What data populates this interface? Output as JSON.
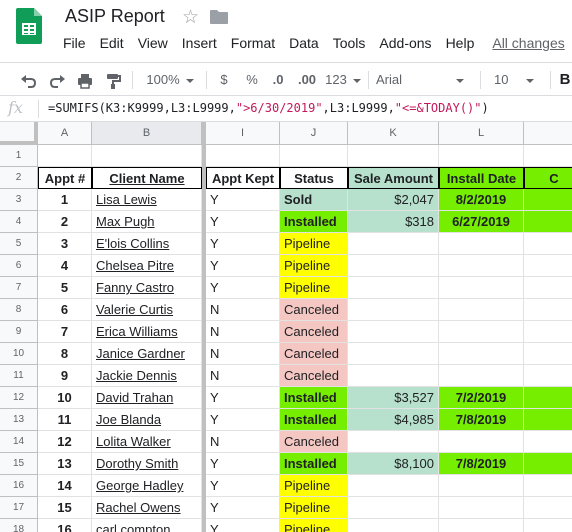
{
  "doc": {
    "title": "ASIP Report"
  },
  "menu": {
    "items": [
      "File",
      "Edit",
      "View",
      "Insert",
      "Format",
      "Data",
      "Tools",
      "Add-ons",
      "Help"
    ],
    "last_edit": "All changes"
  },
  "toolbar": {
    "zoom": "100%",
    "currency": "$",
    "percent": "%",
    "decrease_decimals": ".0",
    "increase_decimals": ".00",
    "more_formats": "123",
    "font": "Arial",
    "font_size": "10"
  },
  "formula_bar": {
    "fx": "fx",
    "parts": [
      {
        "text": "=SUMIFS(K3:K9999,L3:L9999,",
        "type": "code"
      },
      {
        "text": "\">6/30/2019\"",
        "type": "str"
      },
      {
        "text": ",L3:L9999,",
        "type": "code"
      },
      {
        "text": "\"<=&TODAY()\"",
        "type": "str"
      },
      {
        "text": ")",
        "type": "code"
      }
    ]
  },
  "columns": [
    "A",
    "B",
    "I",
    "J",
    "K",
    "L"
  ],
  "selected_column": "B",
  "header_row": {
    "A": "Appt #",
    "B": "Client Name",
    "I": "Appt Kept",
    "J": "Status",
    "K": "Sale Amount",
    "L": "Install Date",
    "M": "C"
  },
  "rows": [
    {
      "n": "3",
      "appt": "1",
      "client": "Lisa Lewis",
      "kept": "Y",
      "status": "Sold",
      "sale": "$2,047",
      "install": "8/2/2019"
    },
    {
      "n": "4",
      "appt": "2",
      "client": "Max Pugh",
      "kept": "Y",
      "status": "Installed",
      "sale": "$318",
      "install": "6/27/2019"
    },
    {
      "n": "5",
      "appt": "3",
      "client": "E'lois Collins",
      "kept": "Y",
      "status": "Pipeline",
      "sale": "",
      "install": ""
    },
    {
      "n": "6",
      "appt": "4",
      "client": "Chelsea Pitre",
      "kept": "Y",
      "status": "Pipeline",
      "sale": "",
      "install": ""
    },
    {
      "n": "7",
      "appt": "5",
      "client": "Fanny Castro",
      "kept": "Y",
      "status": "Pipeline",
      "sale": "",
      "install": ""
    },
    {
      "n": "8",
      "appt": "6",
      "client": "Valerie Curtis",
      "kept": "N",
      "status": "Canceled",
      "sale": "",
      "install": ""
    },
    {
      "n": "9",
      "appt": "7",
      "client": "Erica Williams",
      "kept": "N",
      "status": "Canceled",
      "sale": "",
      "install": ""
    },
    {
      "n": "10",
      "appt": "8",
      "client": "Janice Gardner",
      "kept": "N",
      "status": "Canceled",
      "sale": "",
      "install": ""
    },
    {
      "n": "11",
      "appt": "9",
      "client": "Jackie Dennis",
      "kept": "N",
      "status": "Canceled",
      "sale": "",
      "install": ""
    },
    {
      "n": "12",
      "appt": "10",
      "client": "David Trahan",
      "kept": "Y",
      "status": "Installed",
      "sale": "$3,527",
      "install": "7/2/2019"
    },
    {
      "n": "13",
      "appt": "11",
      "client": "Joe Blanda",
      "kept": "Y",
      "status": "Installed",
      "sale": "$4,985",
      "install": "7/8/2019"
    },
    {
      "n": "14",
      "appt": "12",
      "client": "Lolita Walker",
      "kept": "N",
      "status": "Canceled",
      "sale": "",
      "install": ""
    },
    {
      "n": "15",
      "appt": "13",
      "client": "Dorothy Smith",
      "kept": "Y",
      "status": "Installed",
      "sale": "$8,100",
      "install": "7/8/2019"
    },
    {
      "n": "16",
      "appt": "14",
      "client": "George Hadley",
      "kept": "Y",
      "status": "Pipeline",
      "sale": "",
      "install": ""
    },
    {
      "n": "17",
      "appt": "15",
      "client": "Rachel Owens",
      "kept": "Y",
      "status": "Pipeline",
      "sale": "",
      "install": ""
    },
    {
      "n": "18",
      "appt": "16",
      "client": "carl compton",
      "kept": "Y",
      "status": "Pipeline",
      "sale": "",
      "install": ""
    }
  ],
  "colors": {
    "header_k": "#b7e1cd",
    "header_l": "#76ee00",
    "header_m": "#76ee00",
    "sold": "#b7e1cd",
    "installed": "#76ee00",
    "pipeline": "#ffff00",
    "canceled": "#f4c7c3",
    "sale_bg": "#b7e1cd",
    "install_bg": "#76ee00"
  }
}
